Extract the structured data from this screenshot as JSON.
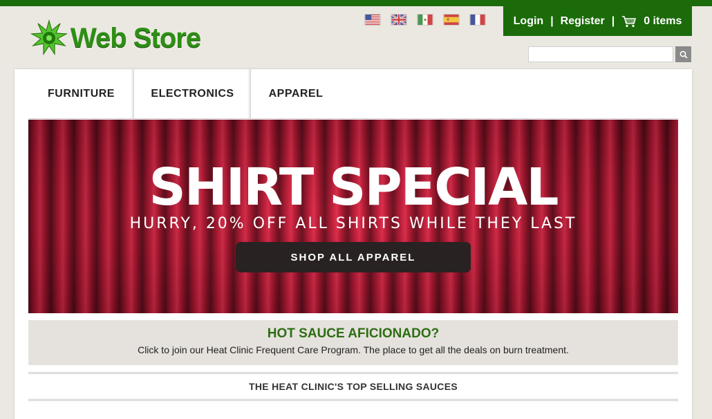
{
  "brand": {
    "name": "Web Store",
    "accent": "#1c6b0b",
    "logo_icon": "green-star-icon"
  },
  "flags": [
    {
      "name": "flag-us-icon"
    },
    {
      "name": "flag-uk-icon"
    },
    {
      "name": "flag-mexico-icon"
    },
    {
      "name": "flag-spain-icon"
    },
    {
      "name": "flag-france-icon"
    }
  ],
  "account": {
    "login": "Login",
    "separator": "|",
    "register": "Register",
    "cart_count": "0",
    "cart_label": "items"
  },
  "search": {
    "value": "",
    "placeholder": ""
  },
  "nav": {
    "tabs": [
      "FURNITURE",
      "ELECTRONICS",
      "APPAREL"
    ]
  },
  "banner": {
    "title": "SHIRT SPECIAL",
    "subtitle": "HURRY, 20% OFF ALL SHIRTS WHILE THEY LAST",
    "button": "SHOP ALL APPAREL"
  },
  "promo": {
    "title": "HOT SAUCE AFICIONADO?",
    "text": "Click to join our Heat Clinic Frequent Care Program. The place to get all the deals on burn treatment."
  },
  "section": {
    "heading": "THE HEAT CLINIC'S TOP SELLING SAUCES"
  }
}
